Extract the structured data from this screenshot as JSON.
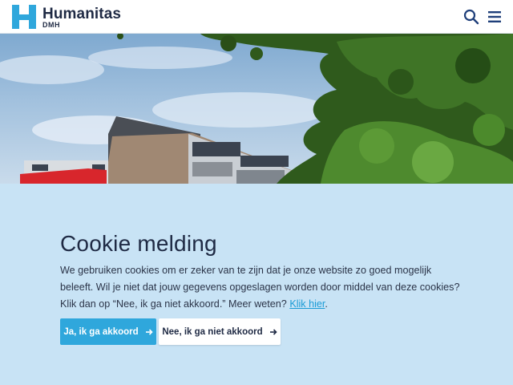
{
  "header": {
    "logo_name": "Humanitas",
    "logo_sub": "DMH",
    "search_icon": "search-icon",
    "menu_icon": "hamburger-menu-icon",
    "brand_color": "#2fa7dc",
    "text_color": "#1f2a44"
  },
  "hero": {
    "image": "apartment-building-with-trees-photo"
  },
  "cookie": {
    "title": "Cookie melding",
    "body": "We gebruiken cookies om er zeker van te zijn dat je onze website zo goed mogelijk beleeft. Wil je niet dat jouw gegevens opgeslagen worden door middel van deze cookies? Klik dan op “Nee, ik ga niet akkoord.” Meer weten? ",
    "link_text": "Klik hier",
    "link_suffix": ".",
    "accept_label": "Ja, ik ga akkoord",
    "decline_label": "Nee, ik ga niet akkoord",
    "arrow_icon": "arrow-right-icon",
    "panel_color": "#c8e3f5",
    "accept_color": "#2fa7dc"
  }
}
